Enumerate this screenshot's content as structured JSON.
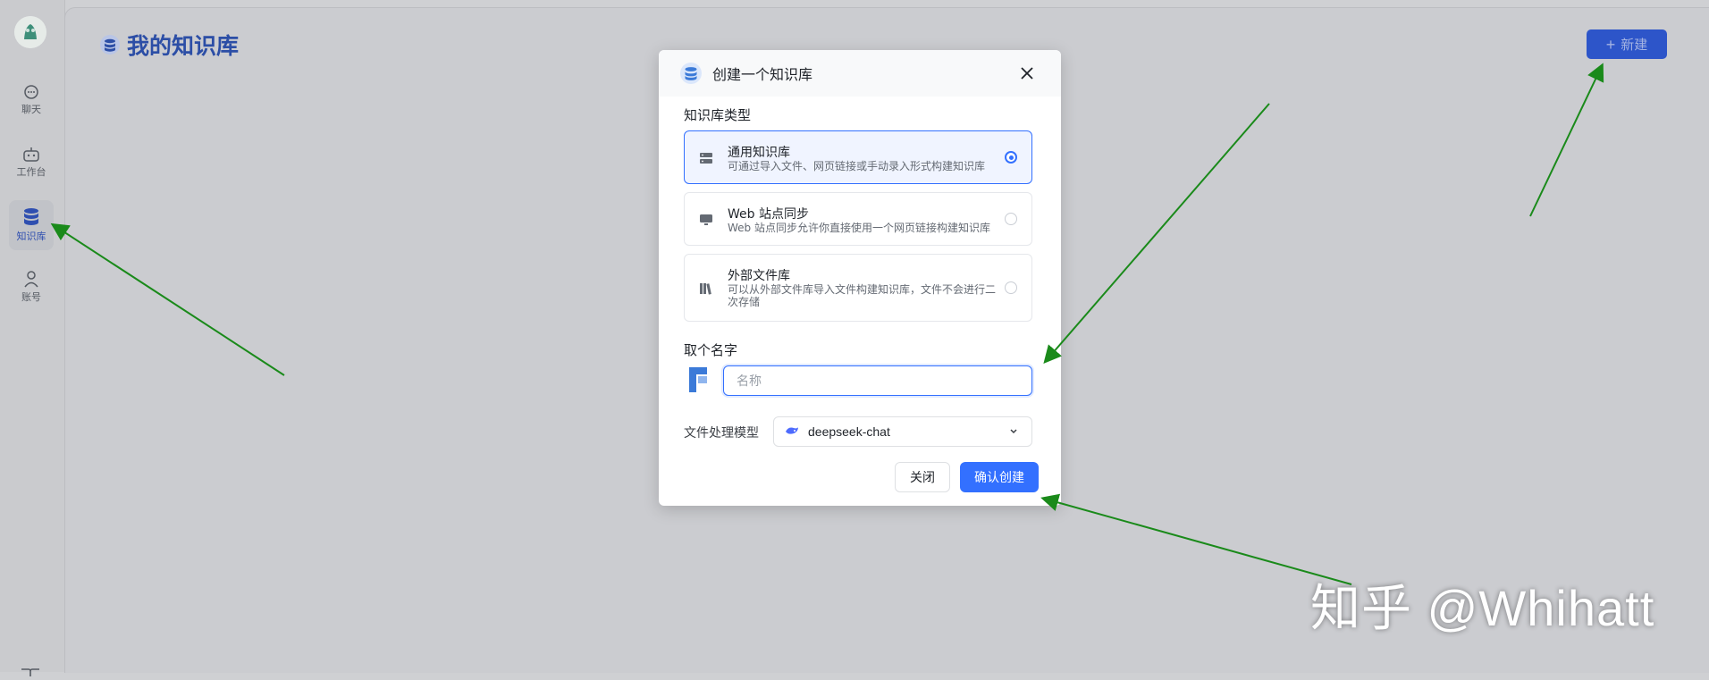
{
  "sidebar": {
    "items": [
      {
        "label": "聊天",
        "icon": "chat-icon"
      },
      {
        "label": "工作台",
        "icon": "robot-icon"
      },
      {
        "label": "知识库",
        "icon": "database-icon",
        "active": true
      },
      {
        "label": "账号",
        "icon": "user-icon"
      }
    ]
  },
  "header": {
    "title": "我的知识库",
    "new_button": "新建"
  },
  "modal": {
    "title": "创建一个知识库",
    "type_label": "知识库类型",
    "options": [
      {
        "title": "通用知识库",
        "desc": "可通过导入文件、网页链接或手动录入形式构建知识库",
        "selected": true
      },
      {
        "title": "Web 站点同步",
        "desc": "Web 站点同步允许你直接使用一个网页链接构建知识库",
        "selected": false
      },
      {
        "title": "外部文件库",
        "desc": "可以从外部文件库导入文件构建知识库，文件不会进行二次存储",
        "selected": false
      }
    ],
    "name_label": "取个名字",
    "name_placeholder": "名称",
    "name_value": "",
    "model_label": "文件处理模型",
    "model_value": "deepseek-chat",
    "cancel_label": "关闭",
    "confirm_label": "确认创建"
  },
  "watermark": "知乎 @Whihatt",
  "colors": {
    "accent": "#3370ff",
    "title_blue": "#2c4ea6",
    "arrow_green": "#1a8a1a"
  }
}
